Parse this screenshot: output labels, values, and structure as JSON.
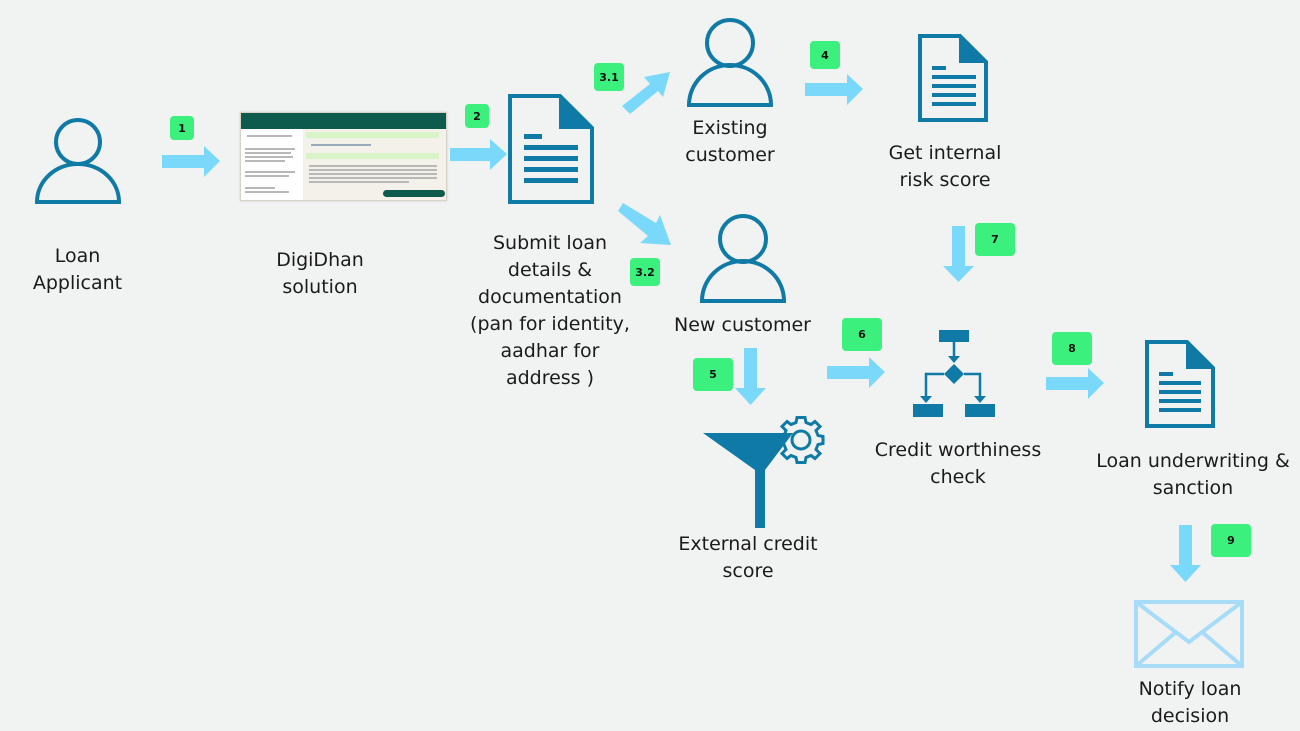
{
  "colors": {
    "background": "#f1f2f2",
    "icon_blue": "#0f7aa6",
    "arrow_blue": "#7ad9fb",
    "badge_green": "#3bf07c",
    "envelope_blue": "#a6dcf7"
  },
  "nodes": {
    "loan_applicant": {
      "label": "Loan\nApplicant",
      "icon": "person-icon"
    },
    "digidhan": {
      "label": "DigiDhan\nsolution",
      "icon": "app-screenshot"
    },
    "submit": {
      "label": "Submit loan\ndetails &\ndocumentation\n(pan for identity,\naadhar for\naddress )",
      "icon": "document-icon"
    },
    "existing_customer": {
      "label": "Existing\ncustomer",
      "icon": "person-icon"
    },
    "new_customer": {
      "label": "New customer",
      "icon": "person-icon"
    },
    "internal_risk": {
      "label": "Get internal\nrisk score",
      "icon": "document-icon"
    },
    "external_credit": {
      "label": "External credit\nscore",
      "icon": "funnel-gear-icon"
    },
    "credit_check": {
      "label": "Credit worthiness\ncheck",
      "icon": "flowchart-icon"
    },
    "underwriting": {
      "label": "Loan underwriting &\nsanction",
      "icon": "document-icon"
    },
    "notify": {
      "label": "Notify  loan\ndecision",
      "icon": "envelope-icon"
    }
  },
  "steps": [
    "1",
    "2",
    "3.1",
    "3.2",
    "4",
    "5",
    "6",
    "7",
    "8",
    "9"
  ]
}
